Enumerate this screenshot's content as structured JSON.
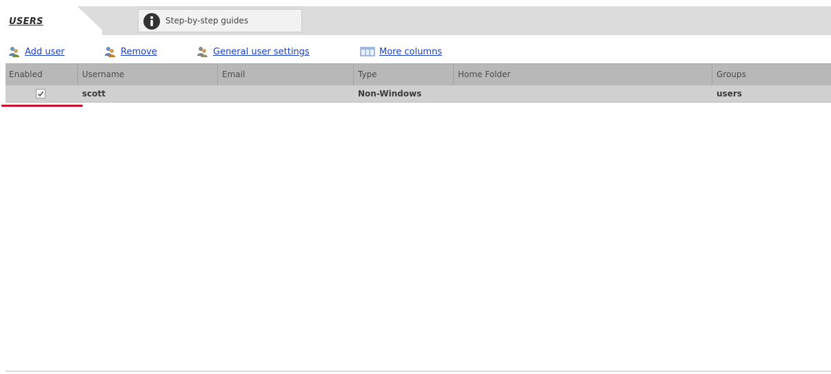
{
  "tabs": {
    "users_label": "USERS",
    "guides_label": "Step-by-step guides"
  },
  "toolbar": {
    "add_user": "Add user",
    "remove": "Remove",
    "general_settings": "General user settings",
    "more_columns": "More columns"
  },
  "table": {
    "columns": [
      "Enabled",
      "Username",
      "Email",
      "Type",
      "Home Folder",
      "Groups"
    ],
    "rows": [
      {
        "enabled": true,
        "username": "scott",
        "email": "",
        "type": "Non-Windows",
        "home_folder": "",
        "groups": "users"
      }
    ]
  },
  "colors": {
    "link": "#1a3ec8",
    "header_bg": "#b8b8b8",
    "row_bg": "#d0d0d0",
    "highlight_underline": "#c8102e"
  },
  "icons": {
    "guides": "info-icon",
    "add_user": "user-add-icon",
    "remove": "user-remove-icon",
    "general_settings": "user-settings-icon",
    "more_columns": "columns-icon"
  }
}
